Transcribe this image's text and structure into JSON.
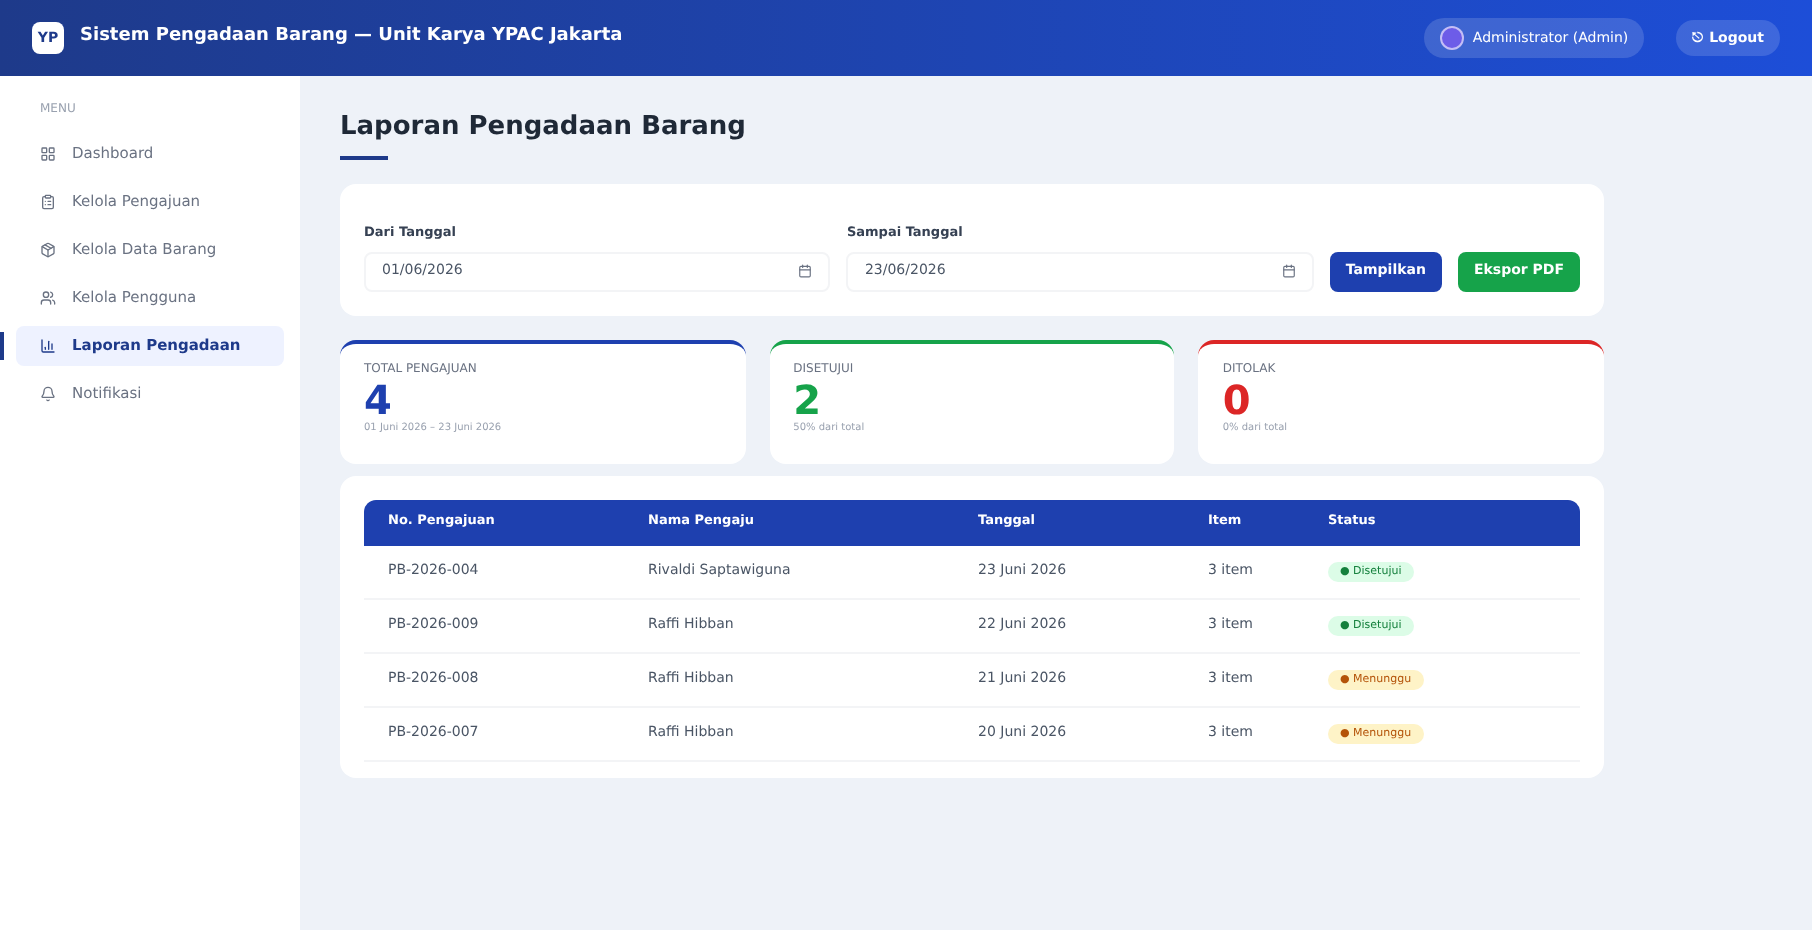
{
  "header": {
    "logo": "YP",
    "title": "Sistem Pengadaan Barang — Unit Karya YPAC Jakarta",
    "user": "Administrator (Admin)",
    "logout": "⎋ Logout"
  },
  "sidebar": {
    "heading": "MENU",
    "items": [
      {
        "label": "Dashboard",
        "selected": false
      },
      {
        "label": "Kelola Pengajuan",
        "selected": false
      },
      {
        "label": "Kelola Data Barang",
        "selected": false
      },
      {
        "label": "Kelola Pengguna",
        "selected": false
      },
      {
        "label": "Laporan Pengadaan",
        "selected": true
      },
      {
        "label": "Notifikasi",
        "selected": false
      }
    ]
  },
  "page_title": "Laporan Pengadaan Barang",
  "filter": {
    "from_label": "Dari Tanggal",
    "from_value": "01/06/2026",
    "to_label": "Sampai Tanggal",
    "to_value": "23/06/2026",
    "show_button": "Tampilkan",
    "export_button": "Ekspor PDF"
  },
  "stats": [
    {
      "label": "TOTAL PENGAJUAN",
      "value": "4",
      "note": "01 Juni 2026 – 23 Juni 2026",
      "color": "#1e40af"
    },
    {
      "label": "DISETUJUI",
      "value": "2",
      "note": "50% dari total",
      "color": "#16a34a"
    },
    {
      "label": "DITOLAK",
      "value": "0",
      "note": "0% dari total",
      "color": "#dc2626"
    }
  ],
  "table": {
    "columns": [
      "No. Pengajuan",
      "Nama Pengaju",
      "Tanggal",
      "Item",
      "Status"
    ],
    "rows": [
      {
        "id": "PB-2026-004",
        "name": "Rivaldi Saptawiguna",
        "date": "23 Juni 2026",
        "items": "3 item",
        "status": "● Disetujui",
        "kind": "approved"
      },
      {
        "id": "PB-2026-009",
        "name": "Raffi Hibban",
        "date": "22 Juni 2026",
        "items": "3 item",
        "status": "● Disetujui",
        "kind": "approved"
      },
      {
        "id": "PB-2026-008",
        "name": "Raffi Hibban",
        "date": "21 Juni 2026",
        "items": "3 item",
        "status": "● Menunggu",
        "kind": "pending"
      },
      {
        "id": "PB-2026-007",
        "name": "Raffi Hibban",
        "date": "20 Juni 2026",
        "items": "3 item",
        "status": "● Menunggu",
        "kind": "pending"
      }
    ]
  }
}
